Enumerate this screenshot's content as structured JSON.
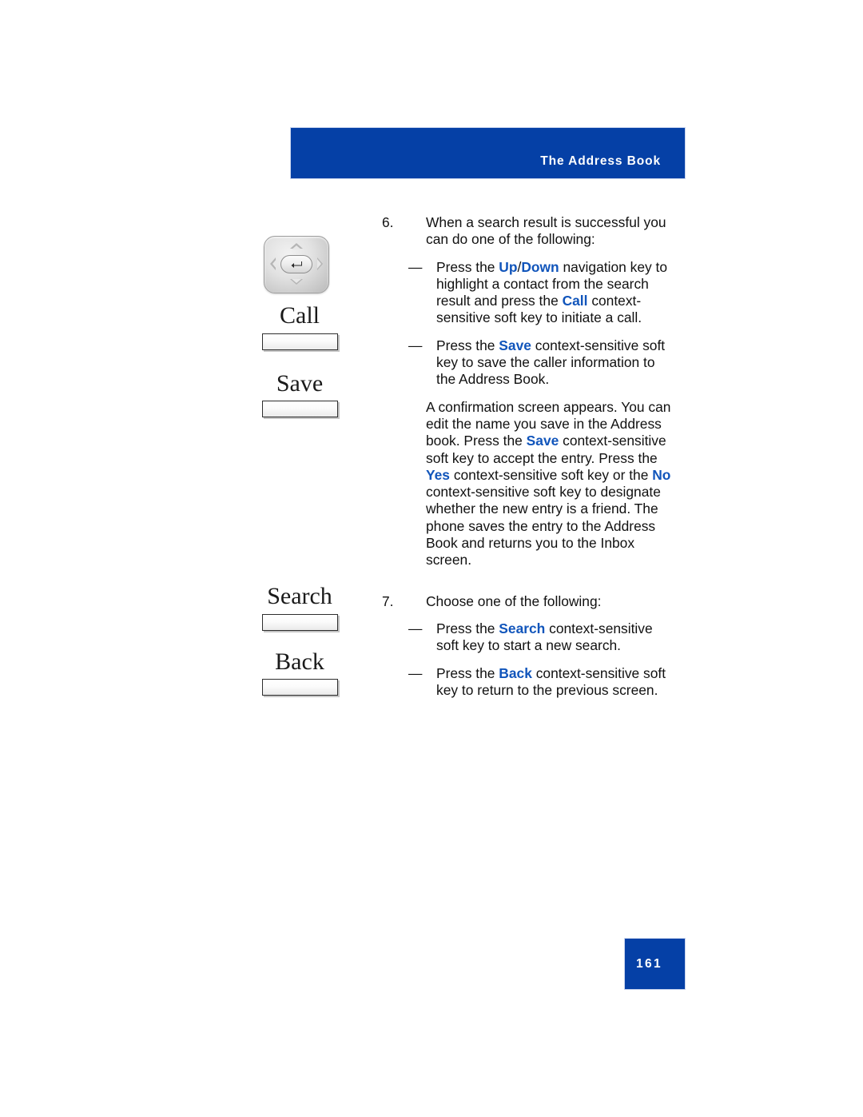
{
  "header": {
    "title": "The Address Book",
    "background_color": "#0540a6",
    "text_color": "#ffffff"
  },
  "illustration": {
    "nav_key_icon": "navigation-key-icon",
    "softkeys": [
      {
        "label": "Call"
      },
      {
        "label": "Save"
      },
      {
        "label": "Search"
      },
      {
        "label": "Back"
      }
    ]
  },
  "content": {
    "accent_color": "#1155bb",
    "step6": {
      "number": "6.",
      "text": "When a search result is successful you can do one of the following:",
      "bullets": [
        {
          "dash": "—",
          "p1": "Press the ",
          "kw1": "Up",
          "sep": "/",
          "kw2": "Down",
          "p2": " navigation key to highlight a contact from the search result and press the ",
          "kw3": "Call",
          "p3": " context-sensitive soft key to initiate a call."
        },
        {
          "dash": "—",
          "p1": "Press the ",
          "kw1": "Save",
          "p2": " context-sensitive soft key to save the caller information to the Address Book."
        }
      ],
      "paragraph": {
        "p1": "A confirmation screen appears. You can edit the name you save in the Address book. Press the ",
        "kw1": "Save",
        "p2": " context-sensitive soft key to accept the entry. Press the ",
        "kw2": "Yes",
        "p3": " context-sensitive soft key or the ",
        "kw3": "No",
        "p4": " context-sensitive soft key to designate whether the new entry is a friend. The phone saves the entry to the Address Book and returns you to the Inbox screen."
      }
    },
    "step7": {
      "number": "7.",
      "text": "Choose one of the following:",
      "bullets": [
        {
          "dash": "—",
          "p1": "Press the ",
          "kw1": "Search",
          "p2": " context-sensitive soft key to start a new search."
        },
        {
          "dash": "—",
          "p1": "Press the ",
          "kw1": "Back",
          "p2": " context-sensitive soft key to return to the previous screen."
        }
      ]
    }
  },
  "footer": {
    "page_number": "161",
    "background_color": "#0540a6"
  }
}
